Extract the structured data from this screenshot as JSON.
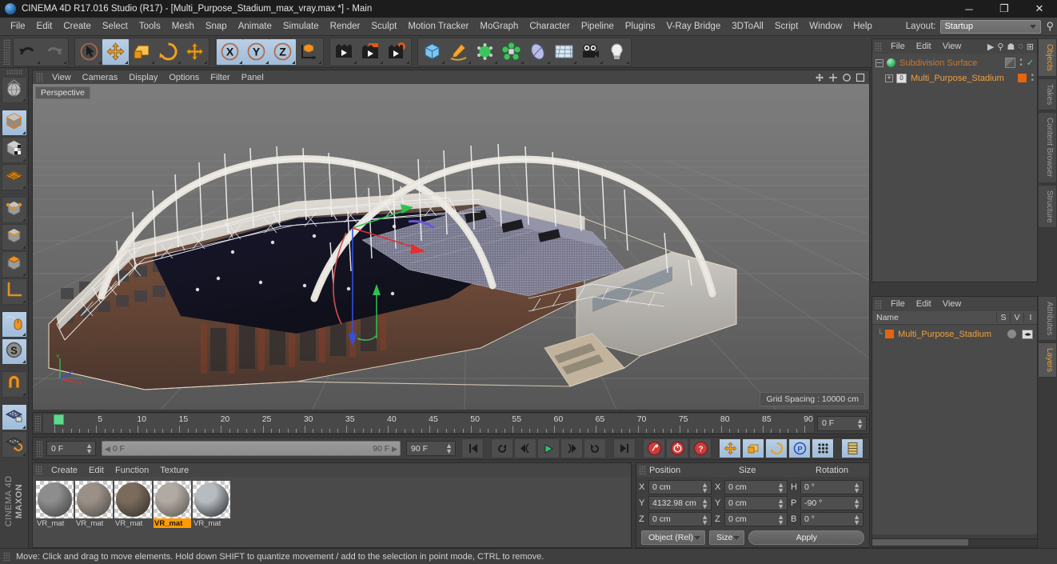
{
  "window": {
    "title": "CINEMA 4D R17.016 Studio (R17) - [Multi_Purpose_Stadium_max_vray.max *] - Main",
    "minimize": "─",
    "maximize": "❐",
    "close": "✕"
  },
  "menu": {
    "items": [
      "File",
      "Edit",
      "Create",
      "Select",
      "Tools",
      "Mesh",
      "Snap",
      "Animate",
      "Simulate",
      "Render",
      "Sculpt",
      "Motion Tracker",
      "MoGraph",
      "Character",
      "Pipeline",
      "Plugins",
      "V-Ray Bridge",
      "3DToAll",
      "Script",
      "Window",
      "Help"
    ],
    "layout_label": "Layout:",
    "layout_value": "Startup",
    "search_icon": "⚲"
  },
  "toolbar": {
    "groups": [
      {
        "name": "history",
        "buttons": [
          {
            "name": "undo-button",
            "icon": "undo-icon",
            "selected": false
          },
          {
            "name": "redo-button",
            "icon": "redo-icon",
            "selected": false
          }
        ]
      },
      {
        "name": "transform",
        "buttons": [
          {
            "name": "live-selection-button",
            "icon": "cursor-icon",
            "selected": false
          },
          {
            "name": "move-tool-button",
            "icon": "move-icon",
            "selected": true
          },
          {
            "name": "scale-tool-button",
            "icon": "scale-icon",
            "selected": false
          },
          {
            "name": "rotate-tool-button",
            "icon": "rotate-icon",
            "selected": false
          },
          {
            "name": "move-duplicate-button",
            "icon": "move-icon",
            "selected": false
          }
        ]
      },
      {
        "name": "axis-lock",
        "buttons": [
          {
            "name": "lock-x-axis-button",
            "icon": "x-axis-icon",
            "selected": true
          },
          {
            "name": "lock-y-axis-button",
            "icon": "y-axis-icon",
            "selected": true
          },
          {
            "name": "lock-z-axis-button",
            "icon": "z-axis-icon",
            "selected": true
          },
          {
            "name": "world-object-coordinates-button",
            "icon": "world-axis-icon",
            "selected": false
          }
        ]
      },
      {
        "name": "render",
        "buttons": [
          {
            "name": "render-view-button",
            "icon": "render-view-icon",
            "selected": false
          },
          {
            "name": "render-to-picture-viewer-button",
            "icon": "render-picture-icon",
            "selected": false
          },
          {
            "name": "render-settings-button",
            "icon": "render-settings-icon",
            "selected": false
          }
        ]
      },
      {
        "name": "create",
        "buttons": [
          {
            "name": "add-cube-button",
            "icon": "cube-icon",
            "selected": false
          },
          {
            "name": "add-spline-button",
            "icon": "pen-icon",
            "selected": false
          },
          {
            "name": "add-generator-button",
            "icon": "generator-icon",
            "selected": false
          },
          {
            "name": "add-mograph-button",
            "icon": "mograph-icon",
            "selected": false
          },
          {
            "name": "add-deformer-button",
            "icon": "deformer-icon",
            "selected": false
          },
          {
            "name": "add-scene-object-button",
            "icon": "floor-icon",
            "selected": false
          },
          {
            "name": "add-camera-button",
            "icon": "camera-icon",
            "selected": false
          },
          {
            "name": "add-light-button",
            "icon": "light-bulb-icon",
            "selected": false
          }
        ]
      }
    ]
  },
  "left_toolbar": {
    "buttons": [
      {
        "name": "make-editable-button",
        "icon": "make-editable-icon",
        "selected": false
      },
      {
        "name": "model-mode-button",
        "icon": "model-cube-icon",
        "selected": true
      },
      {
        "name": "texture-mode-button",
        "icon": "texture-cube-icon",
        "selected": false
      },
      {
        "name": "polygon-grid-button",
        "icon": "polygon-grid-icon",
        "selected": false
      },
      {
        "name": "points-mode-button",
        "icon": "points-cube-icon",
        "selected": false
      },
      {
        "name": "edges-mode-button",
        "icon": "edges-cube-icon",
        "selected": false
      },
      {
        "name": "polygons-mode-button",
        "icon": "polygons-cube-icon",
        "selected": false
      },
      {
        "name": "axis-mode-button",
        "icon": "axis-icon",
        "selected": false
      },
      {
        "name": "viewport-mouse-button",
        "icon": "mouse-icon",
        "selected": true
      },
      {
        "name": "snap-button",
        "icon": "snap-s-icon",
        "selected": true
      },
      {
        "name": "magnet-button",
        "icon": "magnet-icon",
        "selected": false
      },
      {
        "name": "lock-workplane-button",
        "icon": "workplane-lock-icon",
        "selected": true
      },
      {
        "name": "workplane-rotate-button",
        "icon": "workplane-rotate-icon",
        "selected": false
      }
    ],
    "brand_top": "MAXON",
    "brand_bottom": "CINEMA 4D"
  },
  "viewport": {
    "menu_items": [
      "View",
      "Cameras",
      "Display",
      "Options",
      "Filter",
      "Panel"
    ],
    "label": "Perspective",
    "grid_spacing": "Grid Spacing : 10000 cm",
    "axis_labels": {
      "y": "Y",
      "x": "X"
    },
    "corner_icons": [
      "pan-icon",
      "zoom-icon",
      "rotate-icon",
      "maximize-icon"
    ]
  },
  "timeline": {
    "ticks": [
      0,
      5,
      10,
      15,
      20,
      25,
      30,
      35,
      40,
      45,
      50,
      55,
      60,
      65,
      70,
      75,
      80,
      85,
      90
    ],
    "min": 0,
    "max": 90,
    "playhead": 0,
    "current_frame": "0 F"
  },
  "animation": {
    "start_frame": "0 F",
    "range_start": "0 F",
    "range_end": "90 F",
    "end_frame": "90 F",
    "buttons": [
      {
        "name": "go-to-start-button",
        "icon": "skip-start-icon"
      },
      {
        "name": "play-reverse-loop-button",
        "icon": "loop-reverse-icon"
      },
      {
        "name": "previous-frame-button",
        "icon": "step-back-icon"
      },
      {
        "name": "play-button",
        "icon": "play-icon"
      },
      {
        "name": "next-frame-button",
        "icon": "step-forward-icon"
      },
      {
        "name": "play-loop-button",
        "icon": "loop-icon"
      },
      {
        "name": "go-to-end-button",
        "icon": "skip-end-icon"
      },
      {
        "name": "record-keyframe-button",
        "icon": "key-icon"
      },
      {
        "name": "autokeying-button",
        "icon": "autokey-icon"
      },
      {
        "name": "keyframe-selection-button",
        "icon": "question-icon"
      },
      {
        "name": "position-key-button",
        "icon": "move-icon"
      },
      {
        "name": "scale-key-button",
        "icon": "scale-icon"
      },
      {
        "name": "rotation-key-button",
        "icon": "rotate-icon"
      },
      {
        "name": "pla-key-button",
        "icon": "pla-icon"
      },
      {
        "name": "point-level-animation-button",
        "icon": "dots-icon"
      },
      {
        "name": "timeline-button",
        "icon": "timeline-icon"
      }
    ]
  },
  "materials": {
    "menu_items": [
      "Create",
      "Edit",
      "Function",
      "Texture"
    ],
    "items": [
      {
        "name": "VR_mat",
        "selected": false,
        "color1": "#8d8d8d",
        "color2": "#3a3a3a"
      },
      {
        "name": "VR_mat",
        "selected": false,
        "color1": "#9a9088",
        "color2": "#4a4540"
      },
      {
        "name": "VR_mat",
        "selected": false,
        "color1": "#7a6b5c",
        "color2": "#2e2a26"
      },
      {
        "name": "VR_mat",
        "selected": true,
        "color1": "#b0aaa2",
        "color2": "#555049"
      },
      {
        "name": "VR_mat",
        "selected": false,
        "color1": "#b8bcc0",
        "color2": "#1d1f22"
      }
    ]
  },
  "coordinates": {
    "columns": [
      "Position",
      "Size",
      "Rotation"
    ],
    "rows": [
      {
        "pos_label": "X",
        "pos_value": "0 cm",
        "size_label": "X",
        "size_value": "0 cm",
        "rot_label": "H",
        "rot_value": "0 °"
      },
      {
        "pos_label": "Y",
        "pos_value": "4132.98 cm",
        "size_label": "Y",
        "size_value": "0 cm",
        "rot_label": "P",
        "rot_value": "-90 °"
      },
      {
        "pos_label": "Z",
        "pos_value": "0 cm",
        "size_label": "Z",
        "size_value": "0 cm",
        "rot_label": "B",
        "rot_value": "0 °"
      }
    ],
    "coord_system": "Object (Rel)",
    "size_mode": "Size",
    "apply_label": "Apply"
  },
  "object_manager": {
    "menu_items": [
      "File",
      "Edit",
      "View"
    ],
    "rows": [
      {
        "label": "Subdivision Surface",
        "type": "generator",
        "disabled": true
      },
      {
        "label": "Multi_Purpose_Stadium",
        "type": "object",
        "disabled": false,
        "level": 1
      }
    ]
  },
  "layer_manager": {
    "menu_items": [
      "File",
      "Edit",
      "View"
    ],
    "columns": [
      "Name",
      "S",
      "V",
      "I"
    ],
    "rows": [
      {
        "name": "Multi_Purpose_Stadium"
      }
    ]
  },
  "right_tabs_top": [
    {
      "label": "Objects",
      "active": true
    },
    {
      "label": "Takes",
      "active": false
    },
    {
      "label": "Content Browser",
      "active": false
    },
    {
      "label": "Structure",
      "active": false
    }
  ],
  "right_tabs_bottom": [
    {
      "label": "Attributes",
      "active": false
    },
    {
      "label": "Layers",
      "active": true
    }
  ],
  "status": {
    "text": "Move: Click and drag to move elements. Hold down SHIFT to quantize movement / add to the selection in point mode, CTRL to remove."
  },
  "colors": {
    "accent_orange": "#f0a03c",
    "selection_blue": "#9fbcd9",
    "playhead_green": "#5fd98e",
    "axis_x": "#e03030",
    "axis_y": "#30c050",
    "axis_z": "#3050e0"
  }
}
